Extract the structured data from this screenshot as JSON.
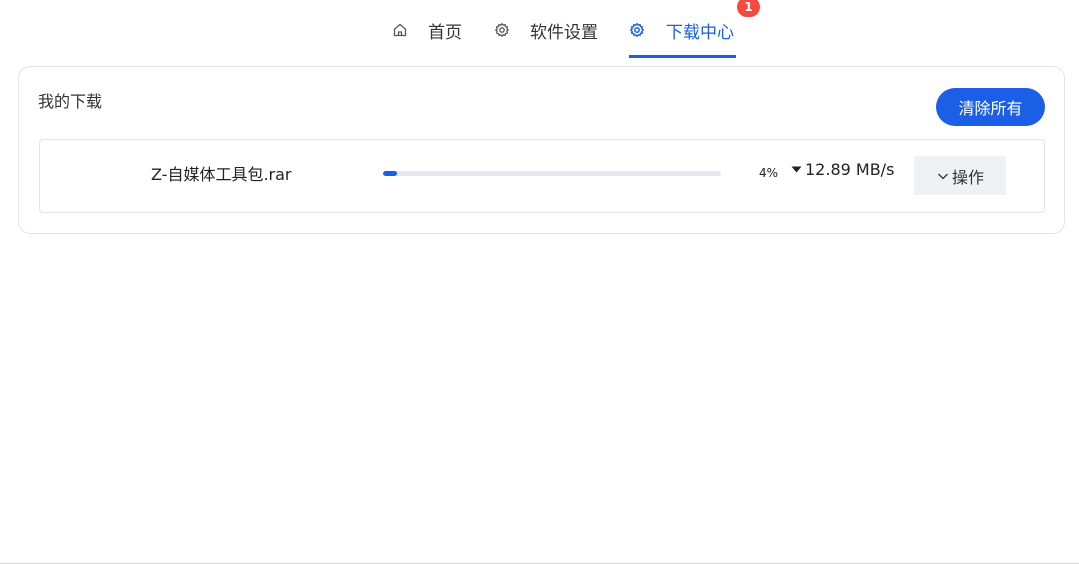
{
  "tabs": [
    {
      "label": "首页",
      "icon": "home-icon"
    },
    {
      "label": "软件设置",
      "icon": "gear-icon"
    },
    {
      "label": "下载中心",
      "icon": "gear-icon",
      "active": true,
      "badge": "1"
    }
  ],
  "panel": {
    "title": "我的下载",
    "clear_all_label": "清除所有"
  },
  "downloads": [
    {
      "filename": "Z-自媒体工具包.rar",
      "progress_percent": 4,
      "percent_label": "4%",
      "speed": "12.89 MB/s",
      "speed_icon": "caret-down-icon",
      "action_label": "操作",
      "action_icon": "chevron-down-icon"
    }
  ],
  "colors": {
    "accent": "#1a5fe6",
    "badge": "#f24a3f",
    "border": "#e2e4ea",
    "track": "#e6e8ef",
    "button_gray": "#f0f1f4"
  }
}
